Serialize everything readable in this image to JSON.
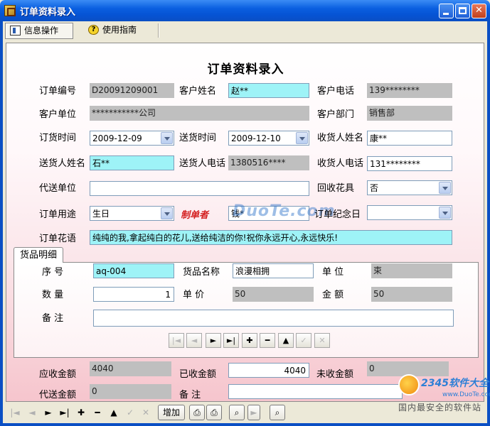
{
  "window": {
    "title": "订单资料录入"
  },
  "toolbar": {
    "info_label": "信息操作",
    "guide_label": "使用指南"
  },
  "form": {
    "heading": "订单资料录入",
    "order_no": {
      "label": "订单编号",
      "value": "D20091209001"
    },
    "customer_name": {
      "label": "客户姓名",
      "value": "赵**"
    },
    "customer_phone": {
      "label": "客户电话",
      "value": "139********"
    },
    "customer_unit": {
      "label": "客户单位",
      "value": "***********公司"
    },
    "customer_dept": {
      "label": "客户部门",
      "value": "销售部"
    },
    "order_time": {
      "label": "订货时间",
      "value": "2009-12-09"
    },
    "delivery_time": {
      "label": "送货时间",
      "value": "2009-12-10"
    },
    "receiver_name": {
      "label": "收货人姓名",
      "value": "康**"
    },
    "deliverer_name": {
      "label": "送货人姓名",
      "value": "石**"
    },
    "deliverer_phone": {
      "label": "送货人电话",
      "value": "1380516****"
    },
    "receiver_phone": {
      "label": "收货人电话",
      "value": "131********"
    },
    "agent_unit": {
      "label": "代送单位",
      "value": ""
    },
    "recycle_flowers": {
      "label": "回收花具",
      "value": "否"
    },
    "order_usage": {
      "label": "订单用途",
      "value": "生日"
    },
    "order_maker": {
      "label": "制单者",
      "value": "钱*"
    },
    "anniversary": {
      "label": "订单纪念日",
      "value": ""
    },
    "flower_words": {
      "label": "订单花语",
      "value": "纯纯的我,拿起纯白的花儿,送给纯洁的你!祝你永远开心,永远快乐!"
    }
  },
  "detail": {
    "tab_label": "货品明细",
    "seq": {
      "label": "序    号",
      "value": "aq-004"
    },
    "goods_name": {
      "label": "货品名称",
      "value": "浪漫相拥"
    },
    "unit": {
      "label": "单    位",
      "value": "束"
    },
    "quantity": {
      "label": "数    量",
      "value": "1"
    },
    "unit_price": {
      "label": "单    价",
      "value": "50"
    },
    "amount": {
      "label": "金    额",
      "value": "50"
    },
    "remark": {
      "label": "备    注",
      "value": ""
    },
    "nav": {
      "first": "|◄",
      "prev": "◄",
      "next": "►",
      "last": "►|",
      "add": "✚",
      "delete": "━",
      "edit": "▲",
      "save": "✓",
      "cancel": "✕"
    }
  },
  "totals": {
    "receivable": {
      "label": "应收金额",
      "value": "4040"
    },
    "received": {
      "label": "已收金额",
      "value": "4040"
    },
    "unreceived": {
      "label": "未收金额",
      "value": "0"
    },
    "agent_amount": {
      "label": "代送金额",
      "value": "0"
    },
    "remark": {
      "label": "备    注",
      "value": ""
    }
  },
  "bottombar": {
    "add_label": "增加"
  },
  "watermarks": {
    "site": "DuoTe.com"
  },
  "badge": {
    "brand": "2345软件大全",
    "url": "www.DuoTe.com",
    "slogan": "国内最安全的软件站"
  },
  "colors": {
    "title_bar": "#0653d4",
    "field_gray": "#bfbfbf",
    "field_cyan": "#9ef3f7",
    "panel_pink": "#f6c5cd"
  }
}
